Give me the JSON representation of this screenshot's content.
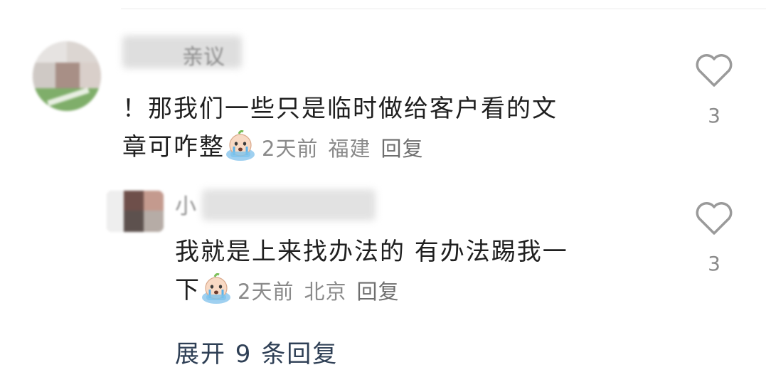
{
  "comments": [
    {
      "username_visible_part": "亲议",
      "text_line1": "！那我们一些只是临时做给客户看的文",
      "text_line2": "章可咋整",
      "time": "2天前",
      "location": "福建",
      "reply_label": "回复",
      "likes": "3",
      "emoji": "crying-face-emoji"
    },
    {
      "username_visible_part": "小",
      "text_line1": "我就是上来找办法的 有办法踢我一",
      "text_line2": "下",
      "time": "2天前",
      "location": "北京",
      "reply_label": "回复",
      "likes": "3",
      "emoji": "crying-face-emoji"
    }
  ],
  "expand_replies": "展开 9 条回复",
  "colors": {
    "text": "#1f1f1f",
    "meta": "#8a8a8a",
    "link": "#2e3f55",
    "heart": "#9a9a9a"
  }
}
